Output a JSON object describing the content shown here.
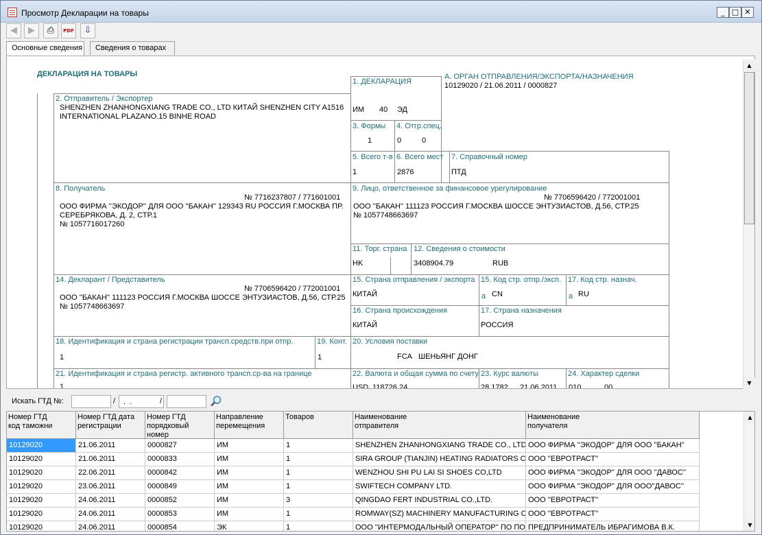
{
  "window": {
    "title": "Просмотр Декларации на товары",
    "minimize": "_",
    "maximize": "□",
    "close": "✕"
  },
  "toolbar": {
    "back": "◀",
    "forward": "▶",
    "print": "⎙",
    "pdf": "PDF",
    "export": "⇩"
  },
  "tabs": [
    {
      "label": "Основные сведения"
    },
    {
      "label": "Сведения о товарах"
    }
  ],
  "declaration": {
    "title": "ДЕКЛАРАЦИЯ НА ТОВАРЫ",
    "f1": {
      "label": "1. ДЕКЛАРАЦИЯ",
      "v1": "ИМ",
      "v2": "40",
      "v3": "ЭД"
    },
    "fA": {
      "label": "А. ОРГАН ОТПРАВЛЕНИЯ/ЭКСПОРТА/НАЗНАЧЕНИЯ",
      "value": "10129020    /  21.06.2011    /  0000827"
    },
    "f2": {
      "label": "2. Отправитель / Экспортер",
      "line1": "SHENZHEN ZHANHONGXIANG TRADE CO., LTD КИТАЙ SHENZHEN CITY A1516",
      "line2": "INTERNATIONAL PLAZANO.15 BINHE ROAD"
    },
    "f3": {
      "label": "3. Формы",
      "value": "1"
    },
    "f4": {
      "label": "4. Отгр.спец.",
      "v1": "0",
      "v2": "0"
    },
    "f5": {
      "label": "5. Всего т-в",
      "value": "1"
    },
    "f6": {
      "label": "6. Всего мест",
      "value": "2876"
    },
    "f7": {
      "label": "7. Справочный номер",
      "value": "ПТД"
    },
    "f8": {
      "label": "8. Получатель",
      "code": "№ 7716237807 / 771601001",
      "line1": "ООО ФИРМА ''ЭКОДОР'' ДЛЯ ООО ''БАКАН'' 129343 RU РОССИЯ Г.МОСКВА ПР.",
      "line2": "СЕРЕБРЯКОВА, Д. 2, СТР.1",
      "line3": "№ 1057716017260"
    },
    "f9": {
      "label": "9. Лицо, ответственное за финансовое урегулирование",
      "code": "№ 7706596420 / 772001001",
      "line1": "ООО ''БАКАН'' 111123 РОССИЯ Г.МОСКВА ШОССЕ ЭНТУЗИАСТОВ, Д.56, СТР.25",
      "line2": "№ 1057748663697"
    },
    "f11": {
      "label": "11. Торг. страна",
      "value": "HK"
    },
    "f12": {
      "label": "12. Сведения о стоимости",
      "value": "3408904.79",
      "currency": "RUB"
    },
    "f14": {
      "label": "14. Декларант / Представитель",
      "code": "№ 7706596420 / 772001001",
      "line1": "ООО ''БАКАН'' 111123 РОССИЯ Г.МОСКВА ШОССЕ ЭНТУЗИАСТОВ, Д.56, СТР.25",
      "line2": "№ 1057748663697"
    },
    "f15": {
      "label": "15. Страна отправления / экспорта",
      "value": "КИТАЙ"
    },
    "f15a": {
      "label": "15. Код стр. отпр./эксп.",
      "prefix": "a",
      "value": "CN"
    },
    "f17a": {
      "label": "17. Код стр. назнач.",
      "prefix": "a",
      "value": "RU"
    },
    "f16": {
      "label": "16. Страна происхождения",
      "value": "КИТАЙ"
    },
    "f17": {
      "label": "17. Страна назначения",
      "value": "РОССИЯ"
    },
    "f18": {
      "label": "18. Идентификация и страна регистрации трансп.средств.при отпр.",
      "value": "1"
    },
    "f19": {
      "label": "19. Конт.",
      "value": "1"
    },
    "f20": {
      "label": "20. Условия поставки",
      "v1": "FCA",
      "v2": "ШЕНЬЯНГ ДОНГ"
    },
    "f21": {
      "label": "21. Идентификация и страна регистр. активного трансп.ср-ва на границе",
      "value": "1"
    },
    "f22": {
      "label": "22. Валюта и общая сумма по счету",
      "v1": "USD",
      "v2": "118726.24"
    },
    "f23": {
      "label": "23. Курс валюты",
      "v1": "28.1782",
      "v2": "21.06.2011"
    },
    "f24": {
      "label": "24. Характер сделки",
      "v1": "010",
      "v2": "00"
    }
  },
  "search": {
    "label": "Искать ГТД №:",
    "f1": "",
    "f2": " .  .",
    "f3": "",
    "sep": "/"
  },
  "grid": {
    "headers": [
      [
        "Номер ГТД",
        "код таможни"
      ],
      [
        "Номер ГТД дата",
        "регистрации"
      ],
      [
        "Номер ГТД",
        "порядковый номер"
      ],
      [
        "Направление",
        "перемещения"
      ],
      [
        "Товаров",
        ""
      ],
      [
        "Наименование",
        "отправителя"
      ],
      [
        "Наименование",
        "получателя"
      ]
    ],
    "rows": [
      [
        "10129020",
        "21.06.2011",
        "0000827",
        "ИМ",
        "1",
        "SHENZHEN ZHANHONGXIANG TRADE CO., LTD",
        "ООО ФИРМА ''ЭКОДОР'' ДЛЯ ООО ''БАКАН''"
      ],
      [
        "10129020",
        "21.06.2011",
        "0000833",
        "ИМ",
        "1",
        "SIRA GROUP (TIANJIN) HEATING RADIATORS CO",
        "ООО ''ЕВРОТРАСТ''"
      ],
      [
        "10129020",
        "22.06.2011",
        "0000842",
        "ИМ",
        "1",
        "WENZHOU SHI PU LAI SI SHOES CO,LTD",
        "ООО ФИРМА ''ЭКОДОР'' ДЛЯ ООО ''ДАВОС''"
      ],
      [
        "10129020",
        "23.06.2011",
        "0000849",
        "ИМ",
        "1",
        "SWIFTECH COMPANY LTD.",
        "ООО ФИРМА ''ЭКОДОР'' ДЛЯ ООО''ДАВОС''"
      ],
      [
        "10129020",
        "24.06.2011",
        "0000852",
        "ИМ",
        "3",
        "QINGDAO FERT INDUSTRIAL CO.,LTD.",
        "ООО ''ЕВРОТРАСТ''"
      ],
      [
        "10129020",
        "24.06.2011",
        "0000853",
        "ИМ",
        "1",
        "ROMWAY(SZ) MACHINERY MANUFACTURING CO",
        "ООО ''ЕВРОТРАСТ''"
      ],
      [
        "10129020",
        "24.06.2011",
        "0000854",
        "ЭК",
        "1",
        "ООО ''ИНТЕРМОДАЛЬНЫЙ ОПЕРАТОР'' ПО ПО",
        "ПРЕДПРИНИМАТЕЛЬ ИБРАГИМОВА В.К."
      ]
    ]
  }
}
